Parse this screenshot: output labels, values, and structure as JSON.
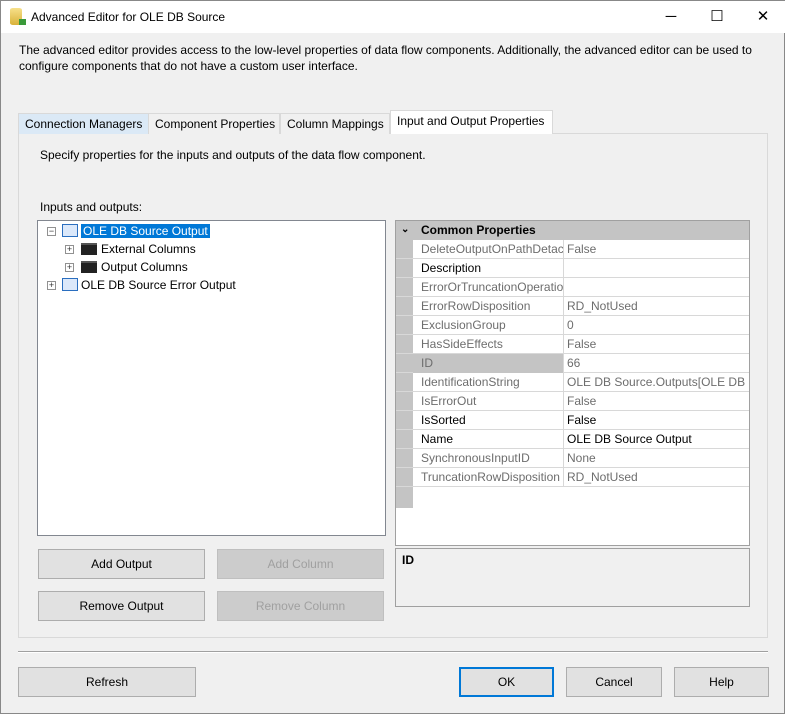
{
  "window": {
    "title": "Advanced Editor for OLE DB Source",
    "minimize": "─",
    "maximize": "☐",
    "close": "✕"
  },
  "description": "The advanced editor provides access to the low-level properties of data flow components. Additionally, the advanced editor can be used to configure components that do not have a custom user interface.",
  "tabs": [
    "Connection Managers",
    "Component Properties",
    "Column Mappings",
    "Input and Output Properties"
  ],
  "panel": {
    "instruction": "Specify properties for the inputs and outputs of the data flow component.",
    "tree_label": "Inputs and outputs:"
  },
  "tree": {
    "output": "OLE DB Source Output",
    "external": "External Columns",
    "outcols": "Output Columns",
    "error": "OLE DB Source Error Output"
  },
  "grid": {
    "category": "Common Properties",
    "rows": [
      {
        "name": "DeleteOutputOnPathDetac",
        "value": "False"
      },
      {
        "name": "Description",
        "value": ""
      },
      {
        "name": "ErrorOrTruncationOperatio",
        "value": ""
      },
      {
        "name": "ErrorRowDisposition",
        "value": "RD_NotUsed"
      },
      {
        "name": "ExclusionGroup",
        "value": "0"
      },
      {
        "name": "HasSideEffects",
        "value": "False"
      },
      {
        "name": "ID",
        "value": "66"
      },
      {
        "name": "IdentificationString",
        "value": "OLE DB Source.Outputs[OLE DB Source Output]"
      },
      {
        "name": "IsErrorOut",
        "value": "False"
      },
      {
        "name": "IsSorted",
        "value": "False"
      },
      {
        "name": "Name",
        "value": "OLE DB Source Output"
      },
      {
        "name": "SynchronousInputID",
        "value": "None"
      },
      {
        "name": "TruncationRowDisposition",
        "value": "RD_NotUsed"
      }
    ]
  },
  "help": {
    "title": "ID"
  },
  "buttons": {
    "add_output": "Add Output",
    "add_column": "Add Column",
    "remove_output": "Remove Output",
    "remove_column": "Remove Column",
    "refresh": "Refresh",
    "ok": "OK",
    "cancel": "Cancel",
    "help": "Help"
  }
}
